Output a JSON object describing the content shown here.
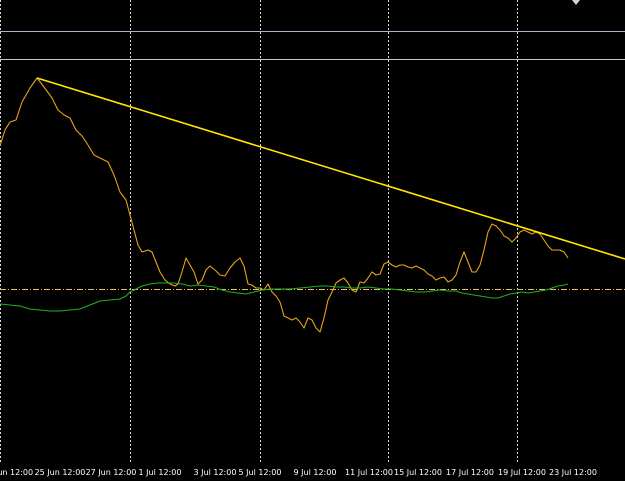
{
  "chart_data": {
    "type": "line",
    "title": "",
    "xlabel": "",
    "ylabel": "",
    "colors": {
      "background": "#000000",
      "grid": "#ffffff",
      "price": "#e8a317",
      "indicator": "#22b022",
      "trendline": "#ffe600",
      "level": "#e8c060",
      "hline": "#aeb6cc",
      "hline2": "#c8c8c8"
    },
    "x_ticks": [
      "Jun 12:00",
      "25 Jun 12:00",
      "27 Jun 12:00",
      "1 Jul 12:00",
      "3 Jul 12:00",
      "5 Jul 12:00",
      "9 Jul 12:00",
      "11 Jul 12:00",
      "15 Jul 12:00",
      "17 Jul 12:00",
      "19 Jul 12:00",
      "23 Jul 12:00"
    ],
    "x_range": [
      0,
      625
    ],
    "y_range": [
      0,
      470
    ],
    "grid": "vertical dotted",
    "horizontal_lines": [
      {
        "name": "level-upper",
        "y": 31,
        "color": "#aeb6cc",
        "style": "solid"
      },
      {
        "name": "level-lower",
        "y": 59,
        "color": "#c8c8c8",
        "style": "solid"
      },
      {
        "name": "signal-level",
        "y": 289,
        "color": "#e8c060",
        "style": "dashdot"
      }
    ],
    "trendline": {
      "x0": 37,
      "y0": 78,
      "x1": 625,
      "y1": 259
    },
    "series": [
      {
        "key": "price",
        "values": [
          [
            0,
            146
          ],
          [
            5,
            130
          ],
          [
            10,
            122
          ],
          [
            16,
            120
          ],
          [
            22,
            102
          ],
          [
            30,
            88
          ],
          [
            37,
            78
          ],
          [
            44,
            87
          ],
          [
            52,
            98
          ],
          [
            58,
            110
          ],
          [
            64,
            115
          ],
          [
            70,
            118
          ],
          [
            76,
            130
          ],
          [
            82,
            136
          ],
          [
            88,
            145
          ],
          [
            94,
            155
          ],
          [
            100,
            158
          ],
          [
            108,
            162
          ],
          [
            114,
            175
          ],
          [
            120,
            192
          ],
          [
            126,
            200
          ],
          [
            130,
            215
          ],
          [
            134,
            230
          ],
          [
            138,
            245
          ],
          [
            142,
            252
          ],
          [
            148,
            250
          ],
          [
            152,
            252
          ],
          [
            156,
            262
          ],
          [
            160,
            272
          ],
          [
            165,
            280
          ],
          [
            170,
            284
          ],
          [
            175,
            286
          ],
          [
            178,
            284
          ],
          [
            182,
            272
          ],
          [
            186,
            258
          ],
          [
            190,
            265
          ],
          [
            194,
            272
          ],
          [
            198,
            284
          ],
          [
            202,
            280
          ],
          [
            206,
            270
          ],
          [
            210,
            266
          ],
          [
            215,
            270
          ],
          [
            220,
            275
          ],
          [
            225,
            276
          ],
          [
            230,
            268
          ],
          [
            235,
            262
          ],
          [
            240,
            258
          ],
          [
            244,
            266
          ],
          [
            248,
            284
          ],
          [
            252,
            285
          ],
          [
            256,
            288
          ],
          [
            260,
            288
          ],
          [
            264,
            290
          ],
          [
            268,
            284
          ],
          [
            272,
            292
          ],
          [
            276,
            296
          ],
          [
            280,
            302
          ],
          [
            284,
            316
          ],
          [
            288,
            318
          ],
          [
            292,
            320
          ],
          [
            296,
            318
          ],
          [
            300,
            322
          ],
          [
            304,
            328
          ],
          [
            308,
            318
          ],
          [
            312,
            320
          ],
          [
            316,
            328
          ],
          [
            320,
            332
          ],
          [
            324,
            318
          ],
          [
            328,
            300
          ],
          [
            332,
            292
          ],
          [
            336,
            283
          ],
          [
            340,
            280
          ],
          [
            344,
            278
          ],
          [
            348,
            283
          ],
          [
            352,
            290
          ],
          [
            356,
            292
          ],
          [
            360,
            282
          ],
          [
            364,
            283
          ],
          [
            368,
            278
          ],
          [
            372,
            272
          ],
          [
            376,
            275
          ],
          [
            380,
            274
          ],
          [
            384,
            264
          ],
          [
            388,
            262
          ],
          [
            392,
            265
          ],
          [
            396,
            267
          ],
          [
            400,
            265
          ],
          [
            404,
            265
          ],
          [
            408,
            267
          ],
          [
            412,
            268
          ],
          [
            416,
            266
          ],
          [
            420,
            268
          ],
          [
            424,
            270
          ],
          [
            428,
            274
          ],
          [
            432,
            276
          ],
          [
            436,
            280
          ],
          [
            440,
            278
          ],
          [
            444,
            277
          ],
          [
            448,
            282
          ],
          [
            452,
            280
          ],
          [
            456,
            275
          ],
          [
            460,
            262
          ],
          [
            464,
            252
          ],
          [
            468,
            262
          ],
          [
            472,
            272
          ],
          [
            476,
            272
          ],
          [
            480,
            265
          ],
          [
            484,
            250
          ],
          [
            488,
            232
          ],
          [
            492,
            224
          ],
          [
            496,
            226
          ],
          [
            500,
            230
          ],
          [
            504,
            236
          ],
          [
            508,
            238
          ],
          [
            512,
            242
          ],
          [
            516,
            238
          ],
          [
            520,
            232
          ],
          [
            524,
            230
          ],
          [
            528,
            232
          ],
          [
            532,
            234
          ],
          [
            536,
            232
          ],
          [
            540,
            234
          ],
          [
            544,
            240
          ],
          [
            548,
            246
          ],
          [
            552,
            250
          ],
          [
            556,
            250
          ],
          [
            560,
            250
          ],
          [
            564,
            252
          ],
          [
            568,
            258
          ]
        ]
      },
      {
        "key": "indicator",
        "values": [
          [
            0,
            304
          ],
          [
            10,
            305
          ],
          [
            20,
            306
          ],
          [
            30,
            309
          ],
          [
            40,
            310
          ],
          [
            50,
            311
          ],
          [
            60,
            311
          ],
          [
            70,
            310
          ],
          [
            80,
            309
          ],
          [
            90,
            305
          ],
          [
            100,
            301
          ],
          [
            110,
            300
          ],
          [
            120,
            299
          ],
          [
            126,
            296
          ],
          [
            130,
            292
          ],
          [
            136,
            289
          ],
          [
            142,
            286
          ],
          [
            150,
            284
          ],
          [
            158,
            283
          ],
          [
            166,
            283
          ],
          [
            174,
            283
          ],
          [
            182,
            284
          ],
          [
            190,
            286
          ],
          [
            198,
            285
          ],
          [
            206,
            286
          ],
          [
            214,
            287
          ],
          [
            222,
            290
          ],
          [
            230,
            292
          ],
          [
            238,
            293
          ],
          [
            246,
            294
          ],
          [
            254,
            292
          ],
          [
            262,
            290
          ],
          [
            270,
            289
          ],
          [
            280,
            289
          ],
          [
            290,
            289
          ],
          [
            300,
            288
          ],
          [
            310,
            287
          ],
          [
            320,
            286
          ],
          [
            328,
            286
          ],
          [
            336,
            287
          ],
          [
            344,
            287
          ],
          [
            352,
            288
          ],
          [
            360,
            288
          ],
          [
            368,
            287
          ],
          [
            376,
            288
          ],
          [
            384,
            289
          ],
          [
            392,
            289
          ],
          [
            400,
            290
          ],
          [
            408,
            291
          ],
          [
            416,
            292
          ],
          [
            424,
            292
          ],
          [
            432,
            291
          ],
          [
            440,
            290
          ],
          [
            448,
            291
          ],
          [
            456,
            291
          ],
          [
            462,
            293
          ],
          [
            468,
            294
          ],
          [
            474,
            295
          ],
          [
            480,
            296
          ],
          [
            486,
            297
          ],
          [
            492,
            298
          ],
          [
            498,
            298
          ],
          [
            504,
            296
          ],
          [
            510,
            294
          ],
          [
            516,
            293
          ],
          [
            522,
            292
          ],
          [
            528,
            293
          ],
          [
            534,
            292
          ],
          [
            540,
            291
          ],
          [
            546,
            290
          ],
          [
            552,
            288
          ],
          [
            558,
            286
          ],
          [
            564,
            285
          ],
          [
            568,
            284
          ]
        ]
      }
    ]
  }
}
